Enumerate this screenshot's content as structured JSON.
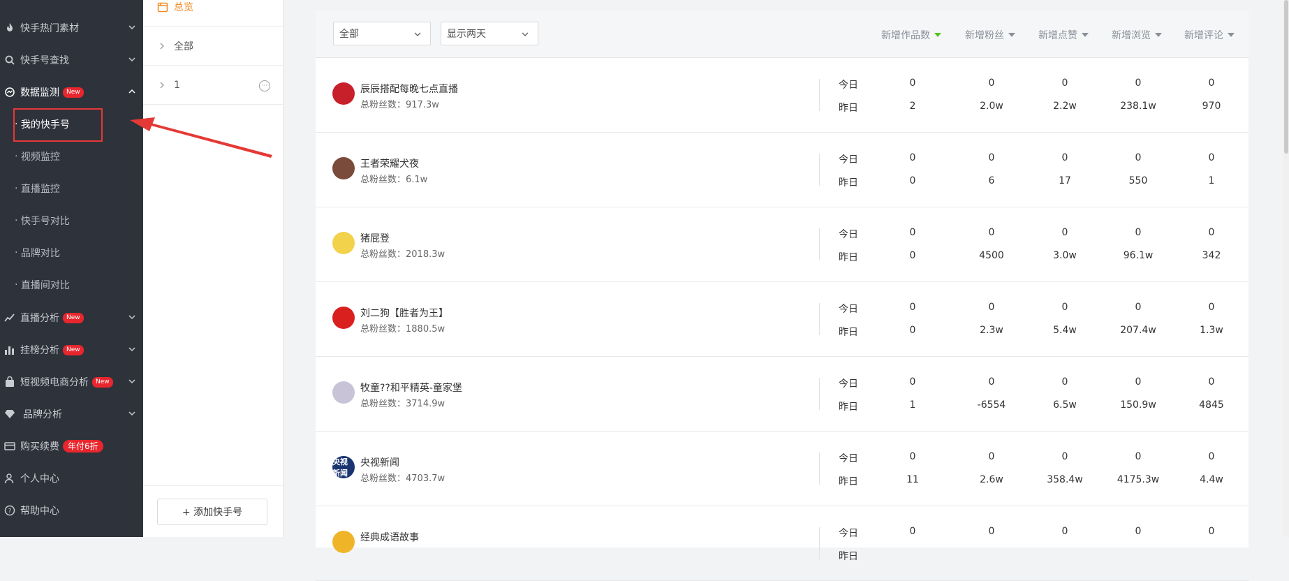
{
  "sidebar": {
    "items": [
      {
        "label": "快手热门素材",
        "icon": "fire-icon"
      },
      {
        "label": "快手号查找",
        "icon": "search-icon"
      },
      {
        "label": "数据监测",
        "icon": "monitor-icon",
        "badge": "New"
      },
      {
        "label": "直播分析",
        "icon": "trend-icon",
        "badge": "New"
      },
      {
        "label": "挂榜分析",
        "icon": "bar-chart-icon",
        "badge": "New"
      },
      {
        "label": "短视频电商分析",
        "icon": "shopping-bag-icon",
        "badge": "New"
      },
      {
        "label": "品牌分析",
        "icon": "diamond-icon"
      },
      {
        "label": "购买续费",
        "icon": "wallet-icon",
        "badge": "年付6折"
      },
      {
        "label": "个人中心",
        "icon": "user-icon"
      },
      {
        "label": "帮助中心",
        "icon": "help-icon"
      }
    ],
    "sub_items": [
      "我的快手号",
      "视频监控",
      "直播监控",
      "快手号对比",
      "品牌对比",
      "直播间对比"
    ]
  },
  "panel2": {
    "overview": "总览",
    "groups": [
      {
        "label": "全部"
      },
      {
        "label": "1"
      }
    ],
    "more_symbol": "···",
    "add_button": "+ 添加快手号"
  },
  "filters": {
    "type": "全部",
    "range": "显示两天"
  },
  "columns": [
    "新增作品数",
    "新增粉丝",
    "新增点赞",
    "新增浏览",
    "新增评论"
  ],
  "labels": {
    "today": "今日",
    "yesterday": "昨日"
  },
  "accounts": [
    {
      "name": "辰辰搭配每晚七点直播",
      "fans": "总粉丝数：917.3w",
      "avatar_color": "#c8202a",
      "avatar_text": "",
      "today": [
        "0",
        "0",
        "0",
        "0",
        "0"
      ],
      "yesterday": [
        "2",
        "2.0w",
        "2.2w",
        "238.1w",
        "970"
      ]
    },
    {
      "name": "王者荣耀犬夜",
      "fans": "总粉丝数：6.1w",
      "avatar_color": "#7a4a3a",
      "avatar_text": "",
      "today": [
        "0",
        "0",
        "0",
        "0",
        "0"
      ],
      "yesterday": [
        "0",
        "6",
        "17",
        "550",
        "1"
      ]
    },
    {
      "name": "猪屁登",
      "fans": "总粉丝数：2018.3w",
      "avatar_color": "#f2d14b",
      "avatar_text": "",
      "today": [
        "0",
        "0",
        "0",
        "0",
        "0"
      ],
      "yesterday": [
        "0",
        "4500",
        "3.0w",
        "96.1w",
        "342"
      ]
    },
    {
      "name": "刘二狗【胜者为王】",
      "fans": "总粉丝数：1880.5w",
      "avatar_color": "#d9201f",
      "avatar_text": "",
      "today": [
        "0",
        "0",
        "0",
        "0",
        "0"
      ],
      "yesterday": [
        "0",
        "2.3w",
        "5.4w",
        "207.4w",
        "1.3w"
      ]
    },
    {
      "name": "牧童??和平精英-童家堡",
      "fans": "总粉丝数：3714.9w",
      "avatar_color": "#c9c3d8",
      "avatar_text": "",
      "today": [
        "0",
        "0",
        "0",
        "0",
        "0"
      ],
      "yesterday": [
        "1",
        "-6554",
        "6.5w",
        "150.9w",
        "4845"
      ]
    },
    {
      "name": "央视新闻",
      "fans": "总粉丝数：4703.7w",
      "avatar_color": "#1a3470",
      "avatar_text": "央视新闻",
      "today": [
        "0",
        "0",
        "0",
        "0",
        "0"
      ],
      "yesterday": [
        "11",
        "2.6w",
        "358.4w",
        "4175.3w",
        "4.4w"
      ]
    },
    {
      "name": "经典成语故事",
      "fans": "",
      "avatar_color": "#f0b429",
      "avatar_text": "",
      "today": [
        "0",
        "0",
        "0",
        "0",
        "0"
      ],
      "yesterday": [
        "",
        "",
        "",
        "",
        ""
      ]
    }
  ],
  "colors": {
    "sidebar_bg": "#2e323b",
    "accent_orange": "#f08a24",
    "badge_red": "#e8262d",
    "sort_active": "#52c41a",
    "annotation_red": "#e53935"
  }
}
